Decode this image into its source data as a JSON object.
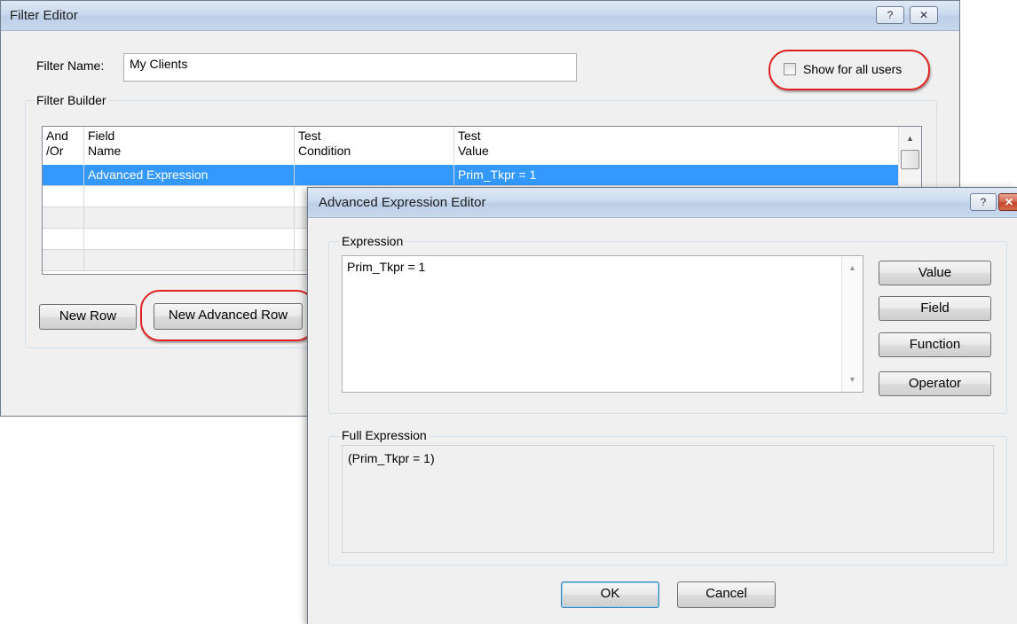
{
  "filter_editor": {
    "title": "Filter Editor",
    "help_glyph": "?",
    "close_glyph": "✕",
    "filter_name_label": "Filter Name:",
    "filter_name_value": "My Clients",
    "show_all_users_label": "Show for all users",
    "show_all_users_checked": false,
    "filter_builder_label": "Filter Builder",
    "columns": [
      {
        "line1": "And",
        "line2": "/Or"
      },
      {
        "line1": "Field",
        "line2": "Name"
      },
      {
        "line1": "Test",
        "line2": "Condition"
      },
      {
        "line1": "Test",
        "line2": "Value"
      }
    ],
    "rows": [
      {
        "and_or": "",
        "field_name": "Advanced Expression",
        "test_condition": "",
        "test_value": "Prim_Tkpr = 1",
        "selected": true
      },
      {
        "and_or": "",
        "field_name": "",
        "test_condition": "",
        "test_value": ""
      },
      {
        "and_or": "",
        "field_name": "",
        "test_condition": "",
        "test_value": ""
      },
      {
        "and_or": "",
        "field_name": "",
        "test_condition": "",
        "test_value": ""
      },
      {
        "and_or": "",
        "field_name": "",
        "test_condition": "",
        "test_value": ""
      }
    ],
    "new_row_label": "New Row",
    "new_advanced_row_label": "New Advanced Row"
  },
  "advanced_editor": {
    "title": "Advanced Expression Editor",
    "help_glyph": "?",
    "close_glyph": "✕",
    "expression_label": "Expression",
    "expression_value": "Prim_Tkpr = 1",
    "buttons": {
      "value": "Value",
      "field": "Field",
      "function": "Function",
      "operator": "Operator"
    },
    "full_expression_label": "Full Expression",
    "full_expression_value": "(Prim_Tkpr = 1)",
    "ok_label": "OK",
    "cancel_label": "Cancel"
  },
  "colors": {
    "selection": "#3399ff",
    "highlight_ring": "#e02020",
    "title_gradient_top": "#dfe9f5",
    "close_button_red": "#c4452a"
  }
}
